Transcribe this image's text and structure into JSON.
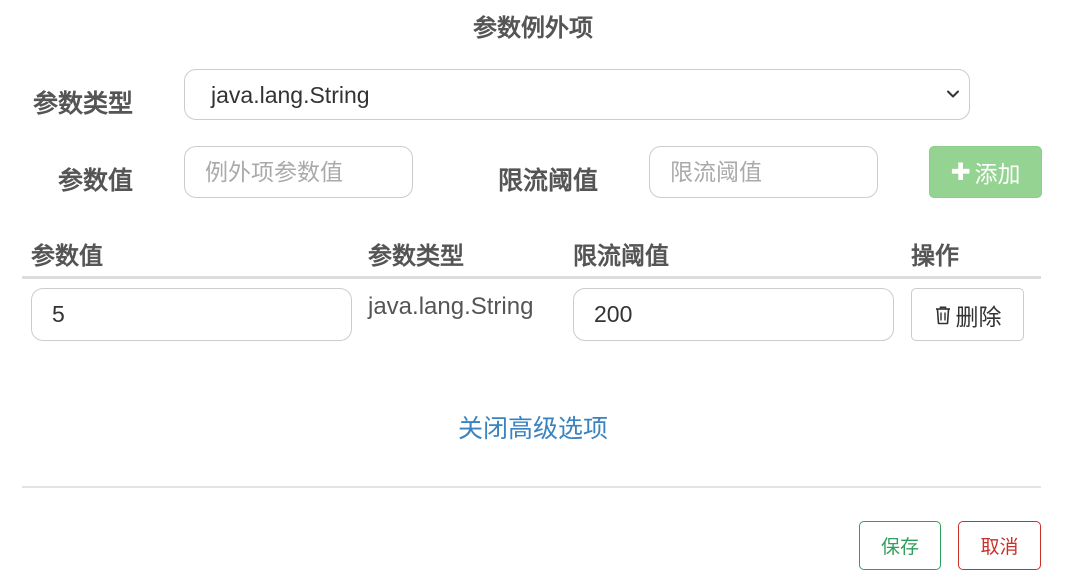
{
  "section": {
    "title": "参数例外项"
  },
  "form": {
    "param_type_label": "参数类型",
    "param_type_value": "java.lang.String",
    "param_value_label": "参数值",
    "param_value_placeholder": "例外项参数值",
    "threshold_label": "限流阈值",
    "threshold_placeholder": "限流阈值",
    "add_button_label": "添加",
    "add_button_icon": "plus-icon",
    "add_button_color": "#94d391"
  },
  "table": {
    "headers": [
      "参数值",
      "参数类型",
      "限流阈值",
      "操作"
    ],
    "rows": [
      {
        "param_value": "5",
        "param_type": "java.lang.String",
        "threshold": "200",
        "delete_label": "删除",
        "delete_icon": "trash-icon"
      }
    ]
  },
  "advanced_link": "关闭高级选项",
  "footer": {
    "save_label": "保存",
    "save_color": "#2fa05b",
    "cancel_label": "取消",
    "cancel_color": "#c9302c"
  },
  "link_color": "#3b83c0"
}
